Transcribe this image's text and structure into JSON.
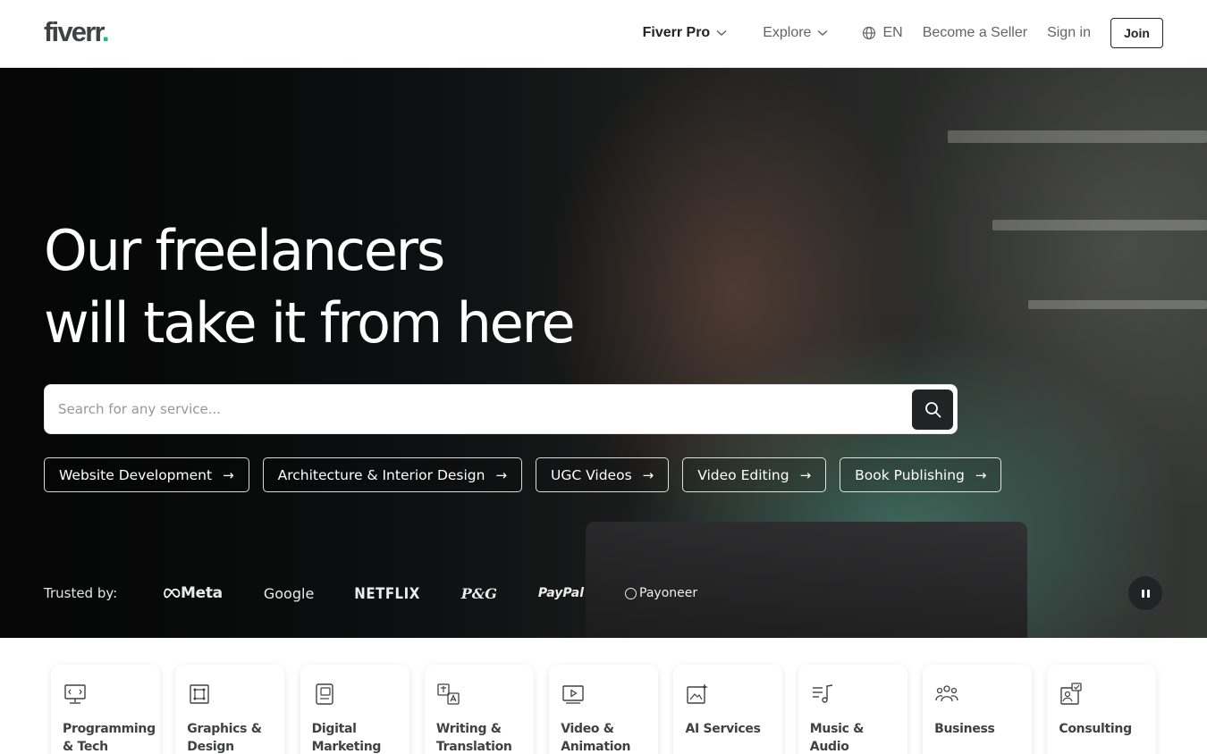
{
  "header": {
    "logo": "fiverr",
    "logo_dot": ".",
    "nav": {
      "pro": "Fiverr Pro",
      "explore": "Explore",
      "language": "EN",
      "become_seller": "Become a Seller",
      "sign_in": "Sign in",
      "join": "Join"
    }
  },
  "hero": {
    "title_line1": "Our freelancers",
    "title_line2": "will take it from here",
    "search": {
      "placeholder": "Search for any service..."
    },
    "chips": [
      "Website Development",
      "Architecture & Interior Design",
      "UGC Videos",
      "Video Editing",
      "Book Publishing"
    ],
    "chip_arrow": "→",
    "trusted_label": "Trusted by:",
    "brands": {
      "meta": "Meta",
      "google": "Google",
      "netflix": "NETFLIX",
      "pg": "P&G",
      "paypal": "PayPal",
      "payoneer": "Payoneer"
    }
  },
  "categories": [
    {
      "label": "Programming\n& Tech",
      "icon": "monitor-icon"
    },
    {
      "label": "Graphics &\nDesign",
      "icon": "design-icon"
    },
    {
      "label": "Digital\nMarketing",
      "icon": "marketing-icon"
    },
    {
      "label": "Writing &\nTranslation",
      "icon": "translation-icon"
    },
    {
      "label": "Video &\nAnimation",
      "icon": "video-icon"
    },
    {
      "label": "AI Services",
      "icon": "ai-icon"
    },
    {
      "label": "Music & Audio",
      "icon": "music-icon"
    },
    {
      "label": "Business",
      "icon": "business-icon"
    },
    {
      "label": "Consulting",
      "icon": "consulting-icon"
    }
  ],
  "colors": {
    "brand_green": "#1dbf73",
    "text_dark": "#222325",
    "text_muted": "#62646a"
  }
}
